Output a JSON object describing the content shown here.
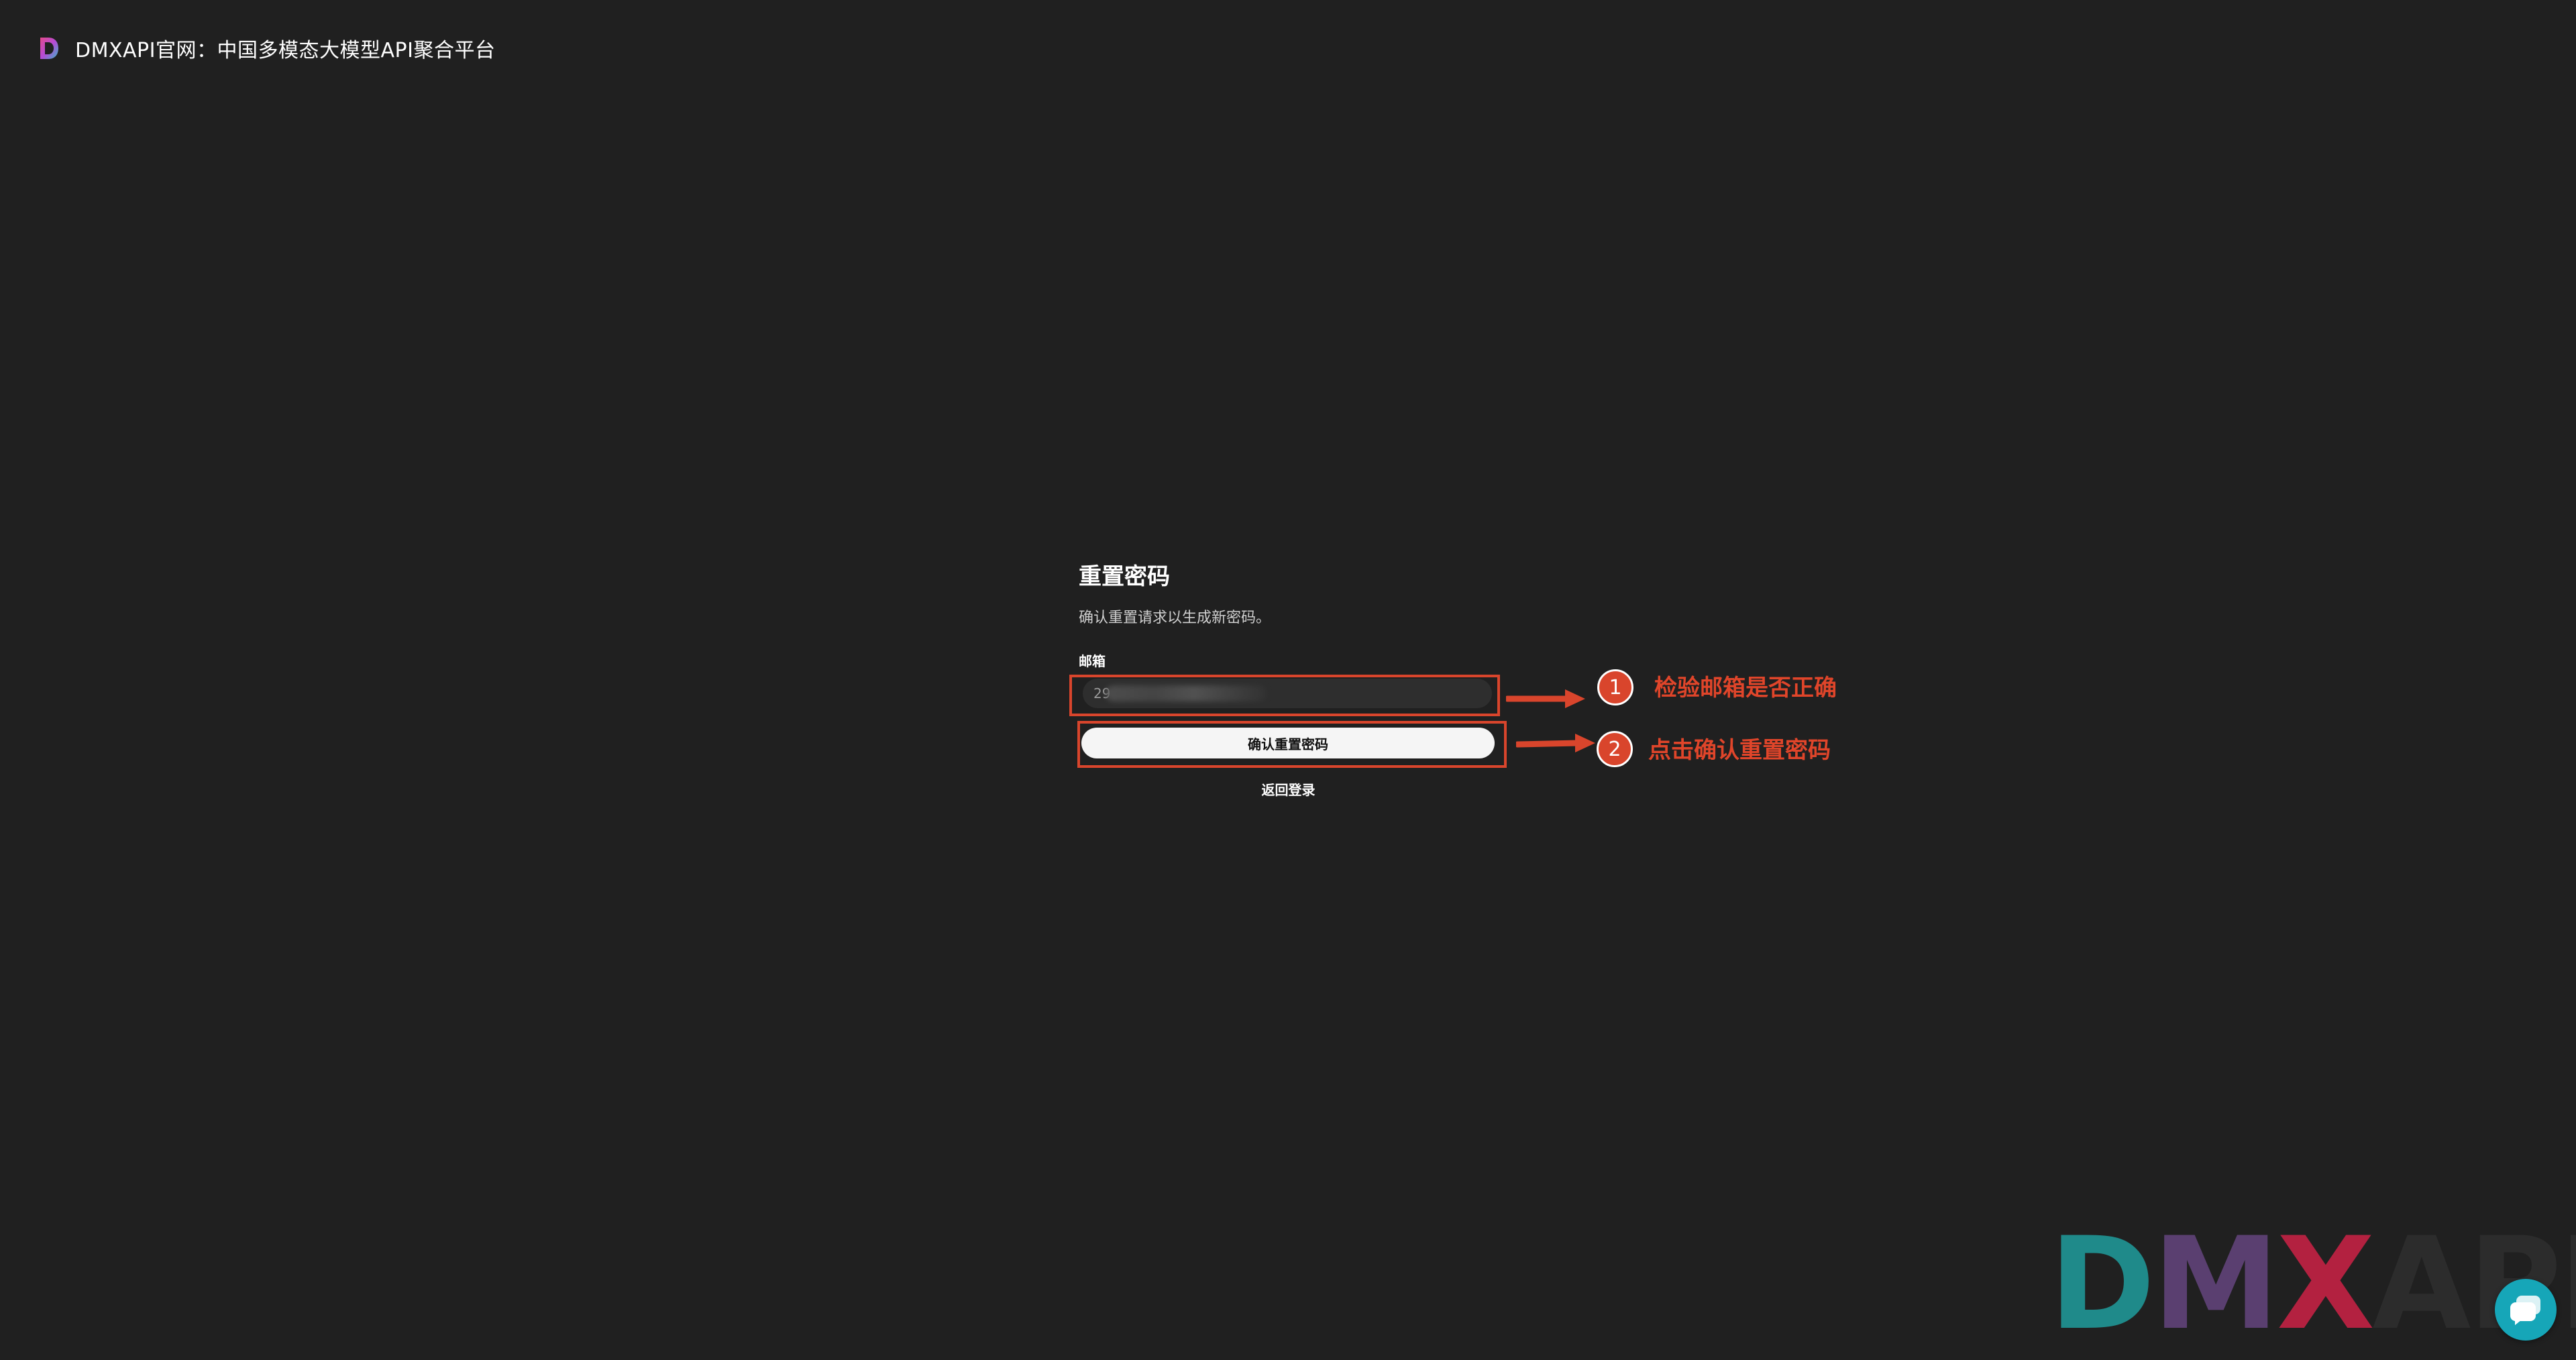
{
  "header": {
    "logo_icon": "dmx-logo-icon",
    "title": "DMXAPI官网：中国多模态大模型API聚合平台"
  },
  "form": {
    "title": "重置密码",
    "subtitle": "确认重置请求以生成新密码。",
    "email_label": "邮箱",
    "email_value": "29",
    "confirm_button": "确认重置密码",
    "back_link": "返回登录"
  },
  "annotations": {
    "step1_number": "1",
    "step1_text": "检验邮箱是否正确",
    "step2_number": "2",
    "step2_text": "点击确认重置密码",
    "color": "#d9452c"
  },
  "watermark": {
    "d": "D",
    "m": "M",
    "x": "X",
    "api": "API"
  },
  "chat_widget": {
    "icon": "chat-icon",
    "color": "#16a6b8"
  }
}
